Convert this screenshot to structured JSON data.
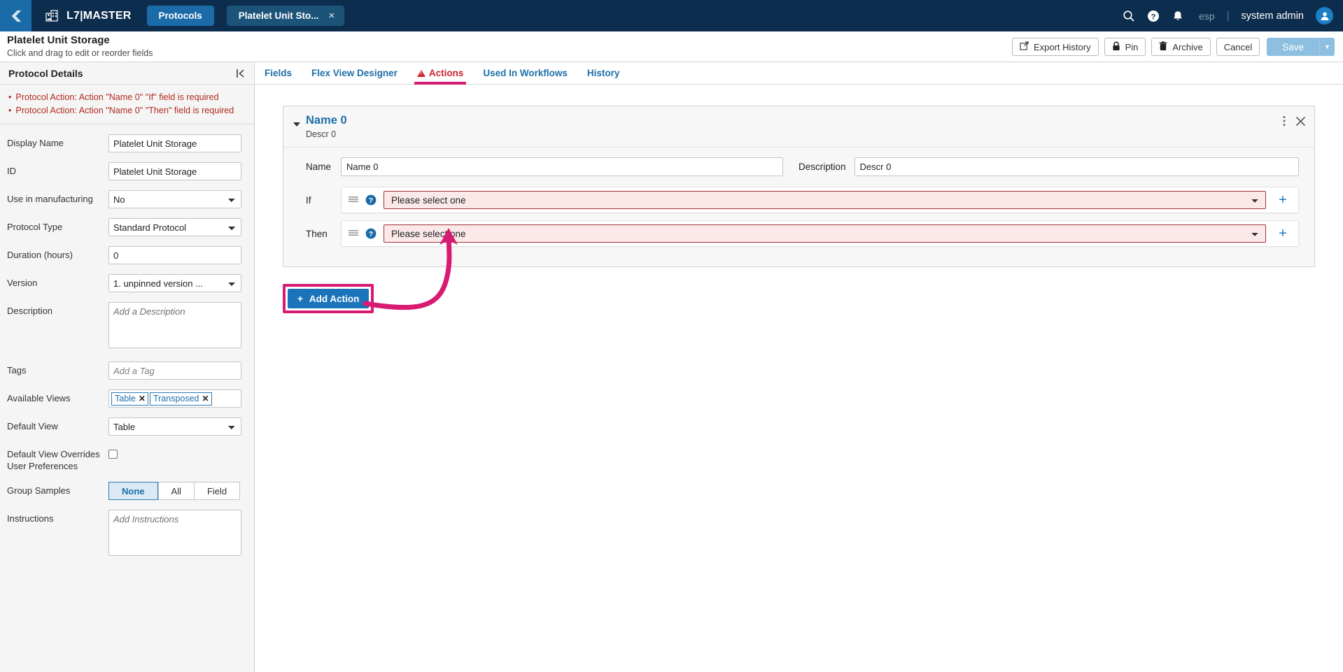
{
  "topnav": {
    "back_icon": "chevron-left-icon",
    "brand": "L7|MASTER",
    "brand_icon": "building-icon",
    "tab_protocols": "Protocols",
    "tab_document": "Platelet Unit Sto...",
    "close_glyph": "×",
    "search_icon": "search-icon",
    "help_icon": "help-circle-icon",
    "bell_icon": "bell-icon",
    "locale": "esp",
    "divider": "|",
    "user": "system admin",
    "avatar_icon": "user-avatar-icon"
  },
  "pageheader": {
    "title": "Platelet Unit Storage",
    "subtitle": "Click and drag to edit or reorder fields",
    "export_history": "Export History",
    "export_icon": "external-link-icon",
    "pin": "Pin",
    "pin_icon": "lock-icon",
    "archive": "Archive",
    "archive_icon": "trash-icon",
    "cancel": "Cancel",
    "save": "Save",
    "save_caret": "▼"
  },
  "sidebar": {
    "heading": "Protocol Details",
    "errors": [
      "Protocol Action: Action \"Name 0\" \"If\" field is required",
      "Protocol Action: Action \"Name 0\" \"Then\" field is required"
    ],
    "fields": {
      "display_name_label": "Display Name",
      "display_name_value": "Platelet Unit Storage",
      "id_label": "ID",
      "id_value": "Platelet Unit Storage",
      "use_in_manufacturing_label": "Use in manufacturing",
      "use_in_manufacturing_value": "No",
      "protocol_type_label": "Protocol Type",
      "protocol_type_value": "Standard Protocol",
      "duration_label": "Duration (hours)",
      "duration_value": "0",
      "version_label": "Version",
      "version_value": "1. unpinned version ...",
      "description_label": "Description",
      "description_placeholder": "Add a Description",
      "description_value": "",
      "tags_label": "Tags",
      "tags_placeholder": "Add a Tag",
      "tags_value": "",
      "available_views_label": "Available Views",
      "available_views_chips": [
        "Table",
        "Transposed"
      ],
      "chip_close_glyph": "✕",
      "default_view_label": "Default View",
      "default_view_value": "Table",
      "default_view_overrides_label": "Default View Overrides User Preferences",
      "default_view_overrides_checked": false,
      "group_samples_label": "Group Samples",
      "group_samples_options": [
        "None",
        "All",
        "Field"
      ],
      "group_samples_selected": "None",
      "instructions_label": "Instructions",
      "instructions_placeholder": "Add Instructions",
      "instructions_value": ""
    }
  },
  "main": {
    "collapse_icon": "panel-collapse-icon",
    "tabs": [
      {
        "label": "Fields",
        "active": false,
        "warning": false
      },
      {
        "label": "Flex View Designer",
        "active": false,
        "warning": false
      },
      {
        "label": "Actions",
        "active": true,
        "warning": true
      },
      {
        "label": "Used In Workflows",
        "active": false,
        "warning": false
      },
      {
        "label": "History",
        "active": false,
        "warning": false
      }
    ],
    "action_card": {
      "title": "Name 0",
      "subtitle": "Descr 0",
      "kebab_icon": "more-vertical-icon",
      "close_icon": "close-icon",
      "name_label": "Name",
      "name_value": "Name 0",
      "description_label": "Description",
      "description_value": "Descr 0",
      "if_label": "If",
      "if_value": "Please select one",
      "then_label": "Then",
      "then_value": "Please select one",
      "drag_icon": "drag-handle-icon",
      "help_icon": "help-circle-icon",
      "add_glyph": "+"
    },
    "add_action_button": "Add Action",
    "add_action_glyph": "+"
  },
  "colors": {
    "nav_bg": "#0d2d4e",
    "accent_blue": "#1b74ba",
    "annotation_pink": "#d81b72",
    "error_red": "#b02a1e",
    "tab_active_red": "#c9242e"
  }
}
